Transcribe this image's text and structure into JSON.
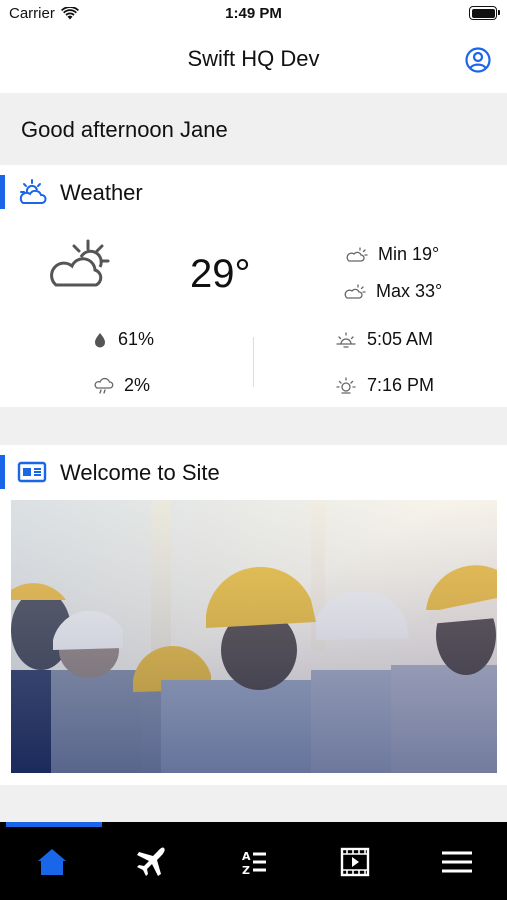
{
  "status_bar": {
    "carrier": "Carrier",
    "time": "1:49 PM"
  },
  "nav": {
    "title": "Swift HQ Dev",
    "profile_icon": "user-circle-icon"
  },
  "greeting": "Good afternoon Jane",
  "weather": {
    "title": "Weather",
    "temperature": "29°",
    "min": "Min 19°",
    "max": "Max 33°",
    "humidity": "61%",
    "rain_chance": "2%",
    "sunrise": "5:05 AM",
    "sunset": "7:16 PM"
  },
  "welcome": {
    "title": "Welcome to Site"
  },
  "tabs": [
    {
      "name": "home",
      "icon": "home-icon",
      "active": true
    },
    {
      "name": "travel",
      "icon": "airplane-icon",
      "active": false
    },
    {
      "name": "directory",
      "icon": "a-z-list-icon",
      "active": false
    },
    {
      "name": "videos",
      "icon": "video-icon",
      "active": false
    },
    {
      "name": "menu",
      "icon": "hamburger-menu-icon",
      "active": false
    }
  ],
  "colors": {
    "accent": "#1a66e8",
    "tab_bar": "#000000"
  }
}
